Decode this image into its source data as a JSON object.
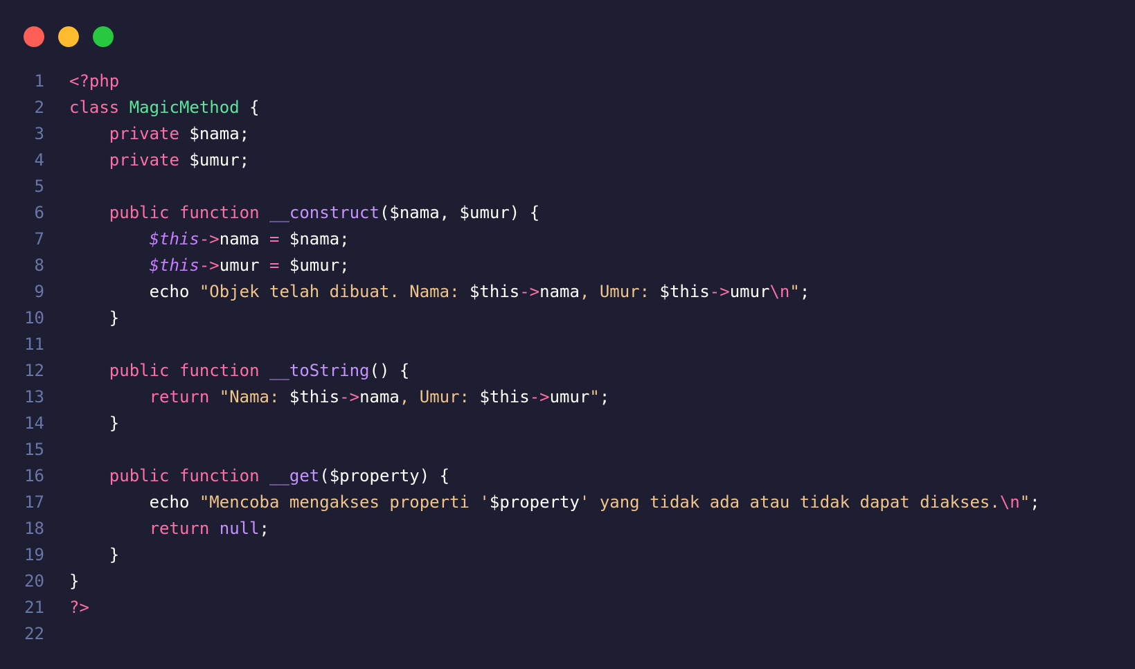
{
  "window_controls": [
    {
      "name": "close",
      "color": "#ff5f57"
    },
    {
      "name": "minimize",
      "color": "#febc2e"
    },
    {
      "name": "zoom",
      "color": "#28c840"
    }
  ],
  "editor": {
    "lines": [
      {
        "number": "1",
        "tokens": [
          {
            "t": "<?php",
            "k": "kw"
          }
        ]
      },
      {
        "number": "2",
        "tokens": [
          {
            "t": "class ",
            "k": "kw"
          },
          {
            "t": "MagicMethod",
            "k": "cls"
          },
          {
            "t": " {",
            "k": "punc"
          }
        ]
      },
      {
        "number": "3",
        "tokens": [
          {
            "t": "    ",
            "k": "plain"
          },
          {
            "t": "private",
            "k": "kw"
          },
          {
            "t": " $nama;",
            "k": "var"
          }
        ]
      },
      {
        "number": "4",
        "tokens": [
          {
            "t": "    ",
            "k": "plain"
          },
          {
            "t": "private",
            "k": "kw"
          },
          {
            "t": " $umur;",
            "k": "var"
          }
        ]
      },
      {
        "number": "5",
        "tokens": []
      },
      {
        "number": "6",
        "tokens": [
          {
            "t": "    ",
            "k": "plain"
          },
          {
            "t": "public function",
            "k": "kw"
          },
          {
            "t": " ",
            "k": "plain"
          },
          {
            "t": "__construct",
            "k": "fn"
          },
          {
            "t": "($nama, $umur) {",
            "k": "var"
          }
        ]
      },
      {
        "number": "7",
        "tokens": [
          {
            "t": "        ",
            "k": "plain"
          },
          {
            "t": "$this",
            "k": "this"
          },
          {
            "t": "->",
            "k": "op"
          },
          {
            "t": "nama ",
            "k": "var"
          },
          {
            "t": "=",
            "k": "op"
          },
          {
            "t": " $nama;",
            "k": "var"
          }
        ]
      },
      {
        "number": "8",
        "tokens": [
          {
            "t": "        ",
            "k": "plain"
          },
          {
            "t": "$this",
            "k": "this"
          },
          {
            "t": "->",
            "k": "op"
          },
          {
            "t": "umur ",
            "k": "var"
          },
          {
            "t": "=",
            "k": "op"
          },
          {
            "t": " $umur;",
            "k": "var"
          }
        ]
      },
      {
        "number": "9",
        "tokens": [
          {
            "t": "        ",
            "k": "plain"
          },
          {
            "t": "echo ",
            "k": "var"
          },
          {
            "t": "\"Objek telah dibuat. Nama: ",
            "k": "str"
          },
          {
            "t": "$this",
            "k": "var"
          },
          {
            "t": "->",
            "k": "op"
          },
          {
            "t": "nama",
            "k": "var"
          },
          {
            "t": ", Umur: ",
            "k": "str"
          },
          {
            "t": "$this",
            "k": "var"
          },
          {
            "t": "->",
            "k": "op"
          },
          {
            "t": "umur",
            "k": "var"
          },
          {
            "t": "\\n",
            "k": "esc"
          },
          {
            "t": "\"",
            "k": "str"
          },
          {
            "t": ";",
            "k": "punc"
          }
        ]
      },
      {
        "number": "10",
        "tokens": [
          {
            "t": "    }",
            "k": "punc"
          }
        ]
      },
      {
        "number": "11",
        "tokens": []
      },
      {
        "number": "12",
        "tokens": [
          {
            "t": "    ",
            "k": "plain"
          },
          {
            "t": "public function",
            "k": "kw"
          },
          {
            "t": " ",
            "k": "plain"
          },
          {
            "t": "__toString",
            "k": "fn"
          },
          {
            "t": "() {",
            "k": "punc"
          }
        ]
      },
      {
        "number": "13",
        "tokens": [
          {
            "t": "        ",
            "k": "plain"
          },
          {
            "t": "return",
            "k": "kw"
          },
          {
            "t": " ",
            "k": "plain"
          },
          {
            "t": "\"Nama: ",
            "k": "str"
          },
          {
            "t": "$this",
            "k": "var"
          },
          {
            "t": "->",
            "k": "op"
          },
          {
            "t": "nama",
            "k": "var"
          },
          {
            "t": ", Umur: ",
            "k": "str"
          },
          {
            "t": "$this",
            "k": "var"
          },
          {
            "t": "->",
            "k": "op"
          },
          {
            "t": "umur",
            "k": "var"
          },
          {
            "t": "\"",
            "k": "str"
          },
          {
            "t": ";",
            "k": "punc"
          }
        ]
      },
      {
        "number": "14",
        "tokens": [
          {
            "t": "    }",
            "k": "punc"
          }
        ]
      },
      {
        "number": "15",
        "tokens": []
      },
      {
        "number": "16",
        "tokens": [
          {
            "t": "    ",
            "k": "plain"
          },
          {
            "t": "public function",
            "k": "kw"
          },
          {
            "t": " ",
            "k": "plain"
          },
          {
            "t": "__get",
            "k": "fn"
          },
          {
            "t": "($property) {",
            "k": "var"
          }
        ]
      },
      {
        "number": "17",
        "tokens": [
          {
            "t": "        ",
            "k": "plain"
          },
          {
            "t": "echo ",
            "k": "var"
          },
          {
            "t": "\"Mencoba mengakses properti '",
            "k": "str"
          },
          {
            "t": "$property",
            "k": "var"
          },
          {
            "t": "' yang tidak ada atau tidak dapat diakses.",
            "k": "str"
          },
          {
            "t": "\\n",
            "k": "esc"
          },
          {
            "t": "\"",
            "k": "str"
          },
          {
            "t": ";",
            "k": "punc"
          }
        ]
      },
      {
        "number": "18",
        "tokens": [
          {
            "t": "        ",
            "k": "plain"
          },
          {
            "t": "return",
            "k": "kw"
          },
          {
            "t": " ",
            "k": "plain"
          },
          {
            "t": "null",
            "k": "fn"
          },
          {
            "t": ";",
            "k": "punc"
          }
        ]
      },
      {
        "number": "19",
        "tokens": [
          {
            "t": "    }",
            "k": "punc"
          }
        ]
      },
      {
        "number": "20",
        "tokens": [
          {
            "t": "}",
            "k": "punc"
          }
        ]
      },
      {
        "number": "21",
        "tokens": [
          {
            "t": "?>",
            "k": "kw"
          }
        ]
      },
      {
        "number": "22",
        "tokens": []
      }
    ]
  }
}
